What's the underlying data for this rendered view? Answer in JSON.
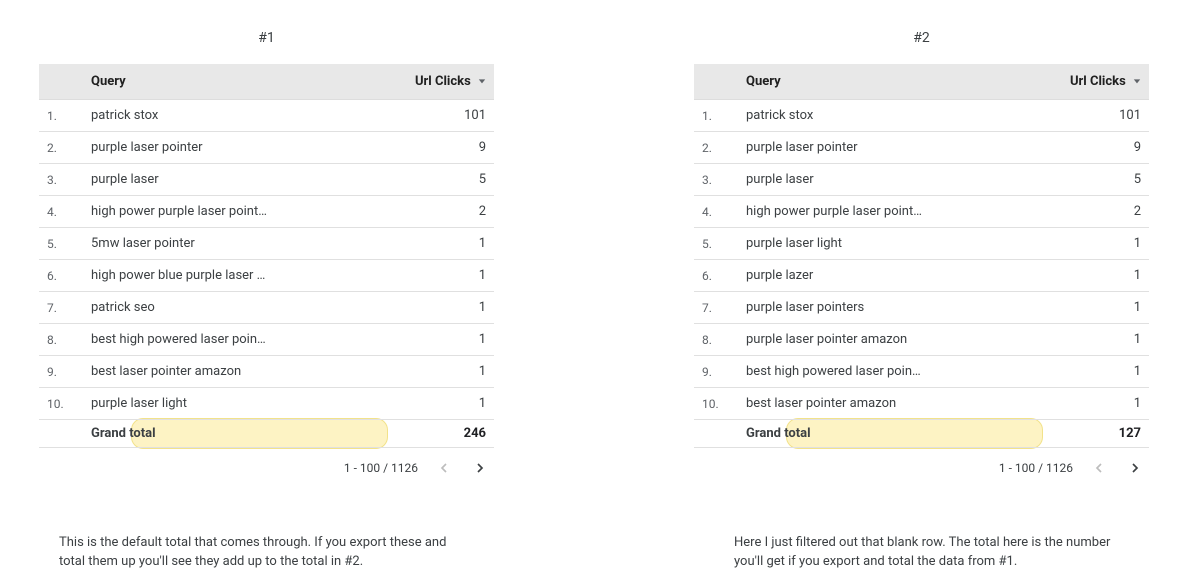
{
  "panels": [
    {
      "title": "#1",
      "headers": {
        "query": "Query",
        "clicks": "Url Clicks"
      },
      "rows": [
        {
          "idx": "1.",
          "query": "patrick stox",
          "clicks": "101"
        },
        {
          "idx": "2.",
          "query": "purple laser pointer",
          "clicks": "9"
        },
        {
          "idx": "3.",
          "query": "purple laser",
          "clicks": "5"
        },
        {
          "idx": "4.",
          "query": "high power purple laser point…",
          "clicks": "2"
        },
        {
          "idx": "5.",
          "query": "5mw laser pointer",
          "clicks": "1"
        },
        {
          "idx": "6.",
          "query": "high power blue purple laser …",
          "clicks": "1"
        },
        {
          "idx": "7.",
          "query": "patrick seo",
          "clicks": "1"
        },
        {
          "idx": "8.",
          "query": "best high powered laser poin…",
          "clicks": "1"
        },
        {
          "idx": "9.",
          "query": "best laser pointer amazon",
          "clicks": "1"
        },
        {
          "idx": "10.",
          "query": "purple laser light",
          "clicks": "1"
        }
      ],
      "grand": {
        "label": "Grand total",
        "value": "246"
      },
      "pager": "1 - 100 / 1126",
      "caption": "This is the default total that comes through. If you export these and total them up you'll see they add up to the total in #2."
    },
    {
      "title": "#2",
      "headers": {
        "query": "Query",
        "clicks": "Url Clicks"
      },
      "rows": [
        {
          "idx": "1.",
          "query": "patrick stox",
          "clicks": "101"
        },
        {
          "idx": "2.",
          "query": "purple laser pointer",
          "clicks": "9"
        },
        {
          "idx": "3.",
          "query": "purple laser",
          "clicks": "5"
        },
        {
          "idx": "4.",
          "query": "high power purple laser point…",
          "clicks": "2"
        },
        {
          "idx": "5.",
          "query": "purple laser light",
          "clicks": "1"
        },
        {
          "idx": "6.",
          "query": "purple lazer",
          "clicks": "1"
        },
        {
          "idx": "7.",
          "query": "purple laser pointers",
          "clicks": "1"
        },
        {
          "idx": "8.",
          "query": "purple laser pointer amazon",
          "clicks": "1"
        },
        {
          "idx": "9.",
          "query": "best high powered laser poin…",
          "clicks": "1"
        },
        {
          "idx": "10.",
          "query": "best laser pointer amazon",
          "clicks": "1"
        }
      ],
      "grand": {
        "label": "Grand total",
        "value": "127"
      },
      "pager": "1 - 100 / 1126",
      "caption": "Here I just filtered out that blank row. The total here is the number you'll get if you export and total the data from #1."
    }
  ]
}
